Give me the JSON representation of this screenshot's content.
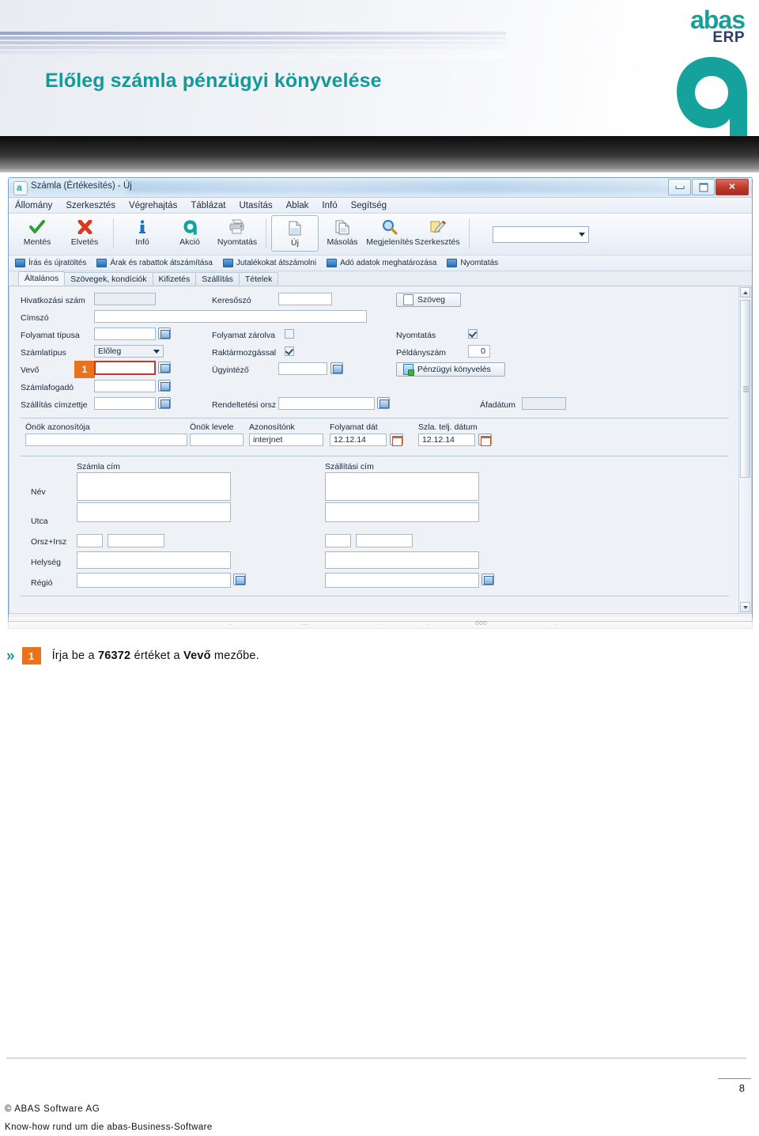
{
  "banner": {
    "title": "Előleg számla pénzügyi könyvelése",
    "logo_abas": "abas",
    "logo_erp": "ERP",
    "accent_color": "#14999a",
    "logo_navy": "#2b3a66"
  },
  "window": {
    "app_icon": "a",
    "title": "Számla (Értékesítés) - Új",
    "buttons": {
      "minimize": "–",
      "maximize": "❐",
      "close": "✕"
    },
    "menu": [
      "Állomány",
      "Szerkesztés",
      "Végrehajtás",
      "Táblázat",
      "Utasítás",
      "Ablak",
      "Infó",
      "Segítség"
    ],
    "toolbar": [
      {
        "label": "Mentés",
        "icon": "check-icon",
        "selected": false
      },
      {
        "label": "Elvetés",
        "icon": "cross-icon",
        "selected": false
      },
      {
        "label": "Infó",
        "icon": "info-icon",
        "selected": false
      },
      {
        "label": "Akció",
        "icon": "abas-a-icon",
        "selected": false
      },
      {
        "label": "Nyomtatás",
        "icon": "printer-icon",
        "selected": false
      },
      {
        "label": "Új",
        "icon": "new-doc-icon",
        "selected": true
      },
      {
        "label": "Másolás",
        "icon": "copy-icon",
        "selected": false
      },
      {
        "label": "Megjelenítés",
        "icon": "magnifier-icon",
        "selected": false
      },
      {
        "label": "Szerkesztés",
        "icon": "edit-pencil-icon",
        "selected": false
      }
    ],
    "toolbar_combo_value": "",
    "option_bar": [
      "Írás és újratöltés",
      "Árak és rabattok átszámítása",
      "Jutalékokat átszámolni",
      "Adó adatok meghatározása",
      "Nyomtatás"
    ],
    "tabs": [
      {
        "label": "Általános",
        "active": true
      },
      {
        "label": "Szövegek, kondíciók",
        "active": false
      },
      {
        "label": "Kifizetés",
        "active": false
      },
      {
        "label": "Szállítás",
        "active": false
      },
      {
        "label": "Tételek",
        "active": false
      }
    ],
    "status_bar": [
      ".",
      "....",
      ".",
      ".",
      "ooo",
      "."
    ]
  },
  "form": {
    "left": {
      "hivatkozasi_szam": {
        "label": "Hivatkozási szám",
        "value": ""
      },
      "cimszo": {
        "label": "Címszó",
        "value": ""
      },
      "folyamat_tipusa": {
        "label": "Folyamat típusa",
        "value": ""
      },
      "szamlatipus": {
        "label": "Számlatípus",
        "value": "Előleg"
      },
      "vevo": {
        "label": "Vevő",
        "value": "",
        "step_badge": "1",
        "highlight_color": "#c0392b"
      },
      "szamlafogado": {
        "label": "Számlafogadó",
        "value": ""
      },
      "szallitas_cimzettje": {
        "label": "Szállítás címzettje",
        "value": ""
      }
    },
    "middle": {
      "keresoszo": {
        "label": "Keresőszó",
        "value": ""
      },
      "folyamat_zarolva": {
        "label": "Folyamat zárolva",
        "checked": false
      },
      "raktarmozgassal": {
        "label": "Raktármozgással",
        "checked": true
      },
      "ugyintezo": {
        "label": "Ügyintéző",
        "value": ""
      },
      "rendeltetesi_orsz": {
        "label": "Rendeltetési orsz",
        "value": ""
      }
    },
    "right": {
      "szoveg_button": {
        "label": "Szöveg"
      },
      "nyomtatas": {
        "label": "Nyomtatás",
        "checked": true
      },
      "peldanyszam": {
        "label": "Példányszám",
        "value": "0"
      },
      "penzugyi_button": {
        "label": "Pénzügyi könyvelés"
      },
      "afadatum": {
        "label": "Áfadátum",
        "value": ""
      }
    },
    "identifiers": {
      "onok_azonositoja": {
        "label": "Önök azonosítója",
        "value": ""
      },
      "onok_levele": {
        "label": "Önök levele",
        "value": ""
      },
      "azonositonk": {
        "label": "Azonosítónk",
        "value": "interjnet"
      },
      "folyamat_dat": {
        "label": "Folyamat dát",
        "value": "12.12.14"
      },
      "szla_telj_datum": {
        "label": "Szla. telj. dátum",
        "value": "12.12.14"
      }
    },
    "address": {
      "billing_caption": "Számla cím",
      "shipping_caption": "Szállítási cím",
      "rows": [
        {
          "label": "Név",
          "billing": "",
          "shipping": ""
        },
        {
          "label": "Utca",
          "billing": "",
          "shipping": ""
        },
        {
          "label": "Orsz+Irsz",
          "billing": "",
          "shipping": ""
        },
        {
          "label": "Helység",
          "billing": "",
          "shipping": ""
        },
        {
          "label": "Régió",
          "billing": "",
          "shipping": ""
        }
      ]
    }
  },
  "instruction": {
    "chevron": "»",
    "step_number": "1",
    "text_part1": "Írja be a ",
    "value": "76372",
    "text_part2": " értéket a ",
    "field": "Vevő",
    "text_part3": " mezőbe."
  },
  "footer": {
    "page_number": "8",
    "line1": "© ABAS Software AG",
    "line2": "Know-how rund um die abas-Business-Software"
  }
}
